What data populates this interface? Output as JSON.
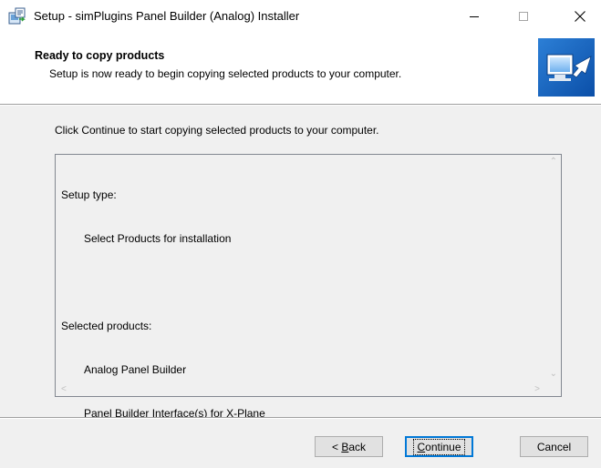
{
  "window": {
    "title": "Setup - simPlugins Panel Builder (Analog) Installer",
    "icon": "setup-installer-icon"
  },
  "header": {
    "title": "Ready to copy products",
    "subtitle": "Setup is now ready to begin copying selected products to your computer.",
    "logo_icon": "computer-install-arrow-icon"
  },
  "body": {
    "instruction": "Click Continue to start copying selected products to your computer.",
    "memo": {
      "setup_type_label": "Setup type:",
      "setup_type_value": "Select Products for installation",
      "products_label": "Selected products:",
      "products": [
        "Analog Panel Builder",
        "Panel Builder Interface(s) for X-Plane"
      ]
    }
  },
  "buttons": {
    "back_prefix": "< ",
    "back_key": "B",
    "back_rest": "ack",
    "continue_key": "C",
    "continue_rest": "ontinue",
    "cancel": "Cancel"
  },
  "colors": {
    "accent": "#0078d7",
    "dialog_bg": "#f0f0f0"
  }
}
